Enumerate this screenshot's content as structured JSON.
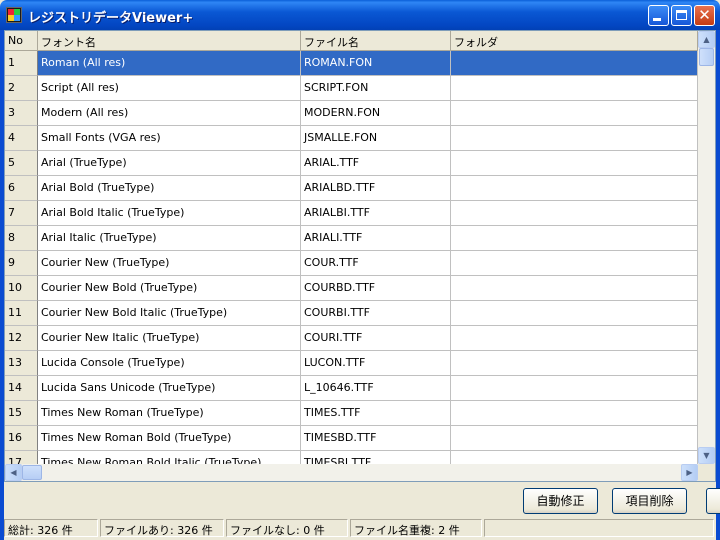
{
  "window": {
    "title": "レジストリデータViewer+",
    "close_glyph": "✕"
  },
  "grid": {
    "columns": [
      "No",
      "フォント名",
      "ファイル名",
      "フォルダ"
    ],
    "selected_row": 1,
    "rows": [
      {
        "no": "1",
        "font": "Roman (All res)",
        "file": "ROMAN.FON",
        "folder": ""
      },
      {
        "no": "2",
        "font": "Script (All res)",
        "file": "SCRIPT.FON",
        "folder": ""
      },
      {
        "no": "3",
        "font": "Modern (All res)",
        "file": "MODERN.FON",
        "folder": ""
      },
      {
        "no": "4",
        "font": "Small Fonts (VGA res)",
        "file": "JSMALLE.FON",
        "folder": ""
      },
      {
        "no": "5",
        "font": "Arial (TrueType)",
        "file": "ARIAL.TTF",
        "folder": ""
      },
      {
        "no": "6",
        "font": "Arial Bold (TrueType)",
        "file": "ARIALBD.TTF",
        "folder": ""
      },
      {
        "no": "7",
        "font": "Arial Bold Italic (TrueType)",
        "file": "ARIALBI.TTF",
        "folder": ""
      },
      {
        "no": "8",
        "font": "Arial Italic (TrueType)",
        "file": "ARIALI.TTF",
        "folder": ""
      },
      {
        "no": "9",
        "font": "Courier New (TrueType)",
        "file": "COUR.TTF",
        "folder": ""
      },
      {
        "no": "10",
        "font": "Courier New Bold (TrueType)",
        "file": "COURBD.TTF",
        "folder": ""
      },
      {
        "no": "11",
        "font": "Courier New Bold Italic (TrueType)",
        "file": "COURBI.TTF",
        "folder": ""
      },
      {
        "no": "12",
        "font": "Courier New Italic (TrueType)",
        "file": "COURI.TTF",
        "folder": ""
      },
      {
        "no": "13",
        "font": "Lucida Console (TrueType)",
        "file": "LUCON.TTF",
        "folder": ""
      },
      {
        "no": "14",
        "font": "Lucida Sans Unicode (TrueType)",
        "file": "L_10646.TTF",
        "folder": ""
      },
      {
        "no": "15",
        "font": "Times New Roman (TrueType)",
        "file": "TIMES.TTF",
        "folder": ""
      },
      {
        "no": "16",
        "font": "Times New Roman Bold (TrueType)",
        "file": "TIMESBD.TTF",
        "folder": ""
      },
      {
        "no": "17",
        "font": "Times New Roman Bold Italic (TrueType)",
        "file": "TIMESBI.TTF",
        "folder": ""
      }
    ]
  },
  "scrollbars": {
    "up_glyph": "▲",
    "down_glyph": "▼",
    "left_glyph": "◀",
    "right_glyph": "▶"
  },
  "buttons": {
    "auto_fix": "自動修正",
    "delete_item": "項目削除"
  },
  "status": {
    "total": "総計:  326 件",
    "found": "ファイルあり:  326 件",
    "missing": "ファイルなし:  0 件",
    "duplicate": "ファイル名重複:  2 件"
  },
  "colors": {
    "title_blue": "#0a58d4",
    "selection": "#316ac5",
    "face": "#ece9d8"
  }
}
